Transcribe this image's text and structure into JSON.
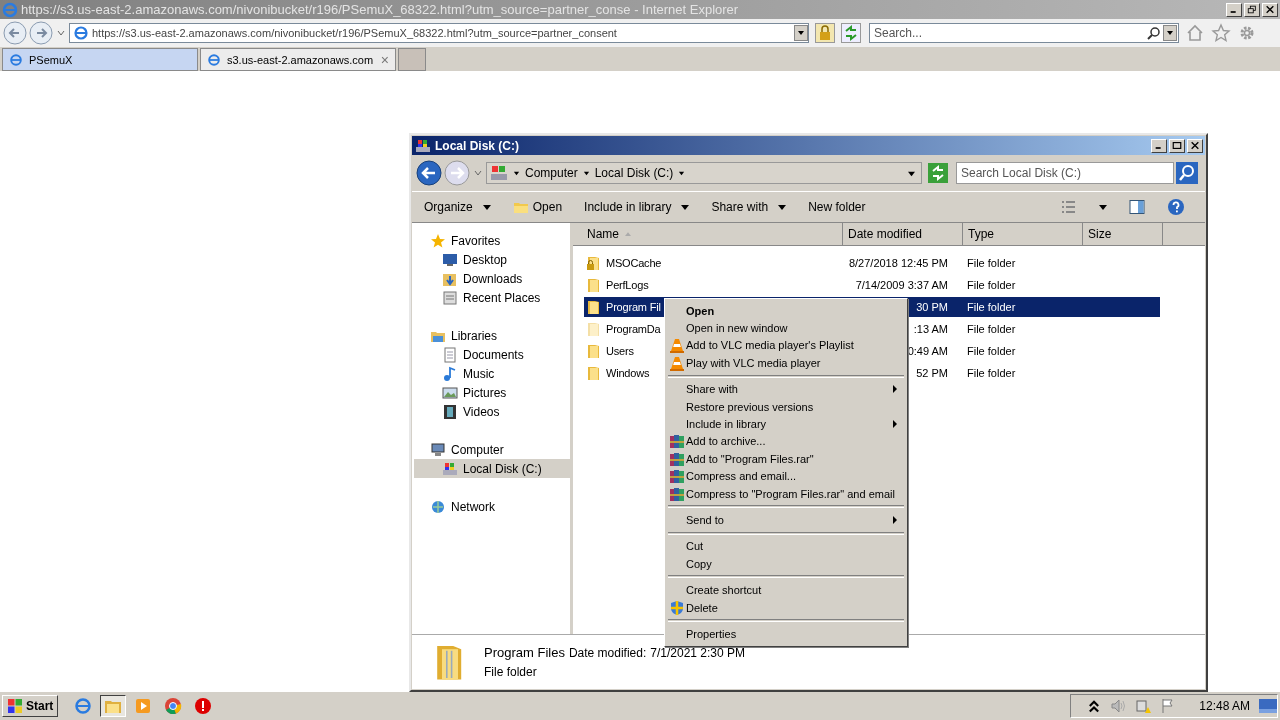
{
  "browser": {
    "title": "https://s3.us-east-2.amazonaws.com/nivonibucket/r196/PSemuX_68322.html?utm_source=partner_conse - Internet Explorer",
    "address": "https://s3.us-east-2.amazonaws.com/nivonibucket/r196/PSemuX_68322.html?utm_source=partner_consent",
    "search": {
      "placeholder": "Search..."
    },
    "tabs": [
      {
        "label": "PSemuX",
        "selected": false
      },
      {
        "label": "s3.us-east-2.amazonaws.com",
        "selected": true,
        "close": "×"
      }
    ]
  },
  "explorer": {
    "title": "Local Disk (C:)",
    "breadcrumb": [
      "Computer",
      "Local Disk (C:)"
    ],
    "search": {
      "placeholder": "Search Local Disk (C:)"
    },
    "toolbar": [
      {
        "label": "Organize",
        "kind": "menu"
      },
      {
        "label": "Open",
        "kind": "open"
      },
      {
        "label": "Include in library",
        "kind": "menu"
      },
      {
        "label": "Share with",
        "kind": "menu"
      },
      {
        "label": "New folder",
        "kind": "plain"
      }
    ],
    "sidebar": [
      {
        "label": "Favorites",
        "kind": "star",
        "selected": false,
        "children": [
          {
            "label": "Desktop",
            "kind": "desktop",
            "selected": false
          },
          {
            "label": "Downloads",
            "kind": "downloads",
            "selected": false
          },
          {
            "label": "Recent Places",
            "kind": "recent",
            "selected": false
          }
        ]
      },
      {
        "label": "Libraries",
        "kind": "library",
        "selected": false,
        "children": [
          {
            "label": "Documents",
            "kind": "documents",
            "selected": false
          },
          {
            "label": "Music",
            "kind": "music",
            "selected": false
          },
          {
            "label": "Pictures",
            "kind": "pictures",
            "selected": false
          },
          {
            "label": "Videos",
            "kind": "videos",
            "selected": false
          }
        ]
      },
      {
        "label": "Computer",
        "kind": "computer",
        "selected": false,
        "children": [
          {
            "label": "Local Disk (C:)",
            "kind": "drive",
            "selected": true
          }
        ]
      },
      {
        "label": "Network",
        "kind": "network",
        "selected": false
      }
    ],
    "columns": [
      "Name",
      "Date modified",
      "Type",
      "Size"
    ],
    "rows": [
      {
        "name": "MSOCache",
        "date": "8/27/2018 12:45 PM",
        "type": "File folder",
        "kind": "locked",
        "selected": false
      },
      {
        "name": "PerfLogs",
        "date": "7/14/2009 3:37 AM",
        "type": "File folder",
        "kind": "folder",
        "selected": false
      },
      {
        "name": "Program Fil",
        "date": "30 PM",
        "type": "File folder",
        "kind": "folder",
        "selected": true
      },
      {
        "name": "ProgramDa",
        "date": ":13 AM",
        "type": "File folder",
        "kind": "hidden",
        "selected": false
      },
      {
        "name": "Users",
        "date": "0:49 AM",
        "type": "File folder",
        "kind": "folder",
        "selected": false
      },
      {
        "name": "Windows",
        "date": "52 PM",
        "type": "File folder",
        "kind": "folder",
        "selected": false
      }
    ],
    "details": {
      "name": "Program Files",
      "date_label": "Date modified:",
      "date": "7/1/2021 2:30 PM",
      "type": "File folder"
    }
  },
  "context_menu": [
    {
      "kind": "item",
      "label": "Open",
      "default": true,
      "submenu": false
    },
    {
      "kind": "item",
      "label": "Open in new window",
      "default": false,
      "submenu": false
    },
    {
      "kind": "vlc",
      "label": "Add to VLC media player's Playlist",
      "default": false,
      "submenu": false
    },
    {
      "kind": "vlc",
      "label": "Play with VLC media player",
      "default": false,
      "submenu": false
    },
    {
      "kind": "separator"
    },
    {
      "kind": "item",
      "label": "Share with",
      "default": false,
      "submenu": true
    },
    {
      "kind": "item",
      "label": "Restore previous versions",
      "default": false,
      "submenu": false
    },
    {
      "kind": "item",
      "label": "Include in library",
      "default": false,
      "submenu": true
    },
    {
      "kind": "archive",
      "label": "Add to archive...",
      "default": false,
      "submenu": false
    },
    {
      "kind": "archive",
      "label": "Add to \"Program Files.rar\"",
      "default": false,
      "submenu": false
    },
    {
      "kind": "archive",
      "label": "Compress and email...",
      "default": false,
      "submenu": false
    },
    {
      "kind": "archive",
      "label": "Compress to \"Program Files.rar\" and email",
      "default": false,
      "submenu": false
    },
    {
      "kind": "separator"
    },
    {
      "kind": "item",
      "label": "Send to",
      "default": false,
      "submenu": true
    },
    {
      "kind": "separator"
    },
    {
      "kind": "item",
      "label": "Cut",
      "default": false,
      "submenu": false
    },
    {
      "kind": "item",
      "label": "Copy",
      "default": false,
      "submenu": false
    },
    {
      "kind": "separator"
    },
    {
      "kind": "item",
      "label": "Create shortcut",
      "default": false,
      "submenu": false
    },
    {
      "kind": "uac",
      "label": "Delete",
      "default": false,
      "submenu": false
    },
    {
      "kind": "separator"
    },
    {
      "kind": "item",
      "label": "Properties",
      "default": false,
      "submenu": false
    }
  ],
  "taskbar": {
    "start": "Start",
    "apps": [
      {
        "kind": "ie",
        "selected": false
      },
      {
        "kind": "folder",
        "selected": true
      },
      {
        "kind": "media",
        "selected": false
      },
      {
        "kind": "chrome",
        "selected": false
      },
      {
        "kind": "stop",
        "selected": false
      }
    ],
    "clock": "12:48 AM"
  }
}
